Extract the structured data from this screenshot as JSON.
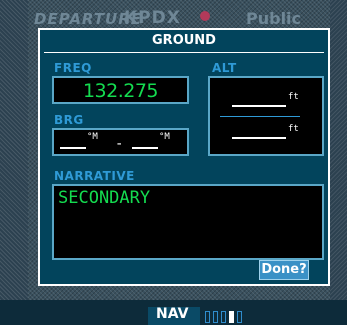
{
  "background": {
    "page_title": "DEPARTURE",
    "airport_id": "KPDX",
    "airport_type": "Public"
  },
  "dialog": {
    "title": "GROUND",
    "freq": {
      "label": "FREQ",
      "value": "132.275"
    },
    "alt": {
      "label": "ALT",
      "top": {
        "dashes": "_____",
        "unit": "ft"
      },
      "bottom": {
        "dashes": "_____",
        "unit": "ft"
      }
    },
    "brg": {
      "label": "BRG",
      "from": {
        "dashes": "___",
        "unit": "°M"
      },
      "separator": "-",
      "to": {
        "dashes": "___",
        "unit": "°M"
      }
    },
    "narrative": {
      "label": "NARRATIVE",
      "value": "SECONDARY"
    },
    "done_label": "Done?"
  },
  "status_bar": {
    "mode": "NAV",
    "page_count": 5,
    "active_page": 4
  },
  "colors": {
    "dialog_bg": "#02445c",
    "label_blue": "#2f9ad6",
    "value_green": "#14dc50",
    "button_blue": "#3a91c6"
  }
}
